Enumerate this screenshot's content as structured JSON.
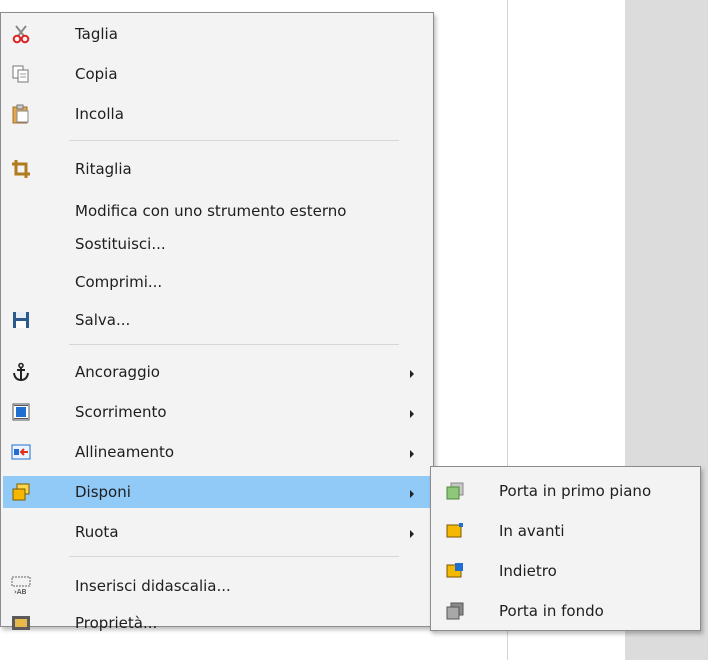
{
  "context_menu": {
    "items": [
      {
        "label": "Taglia",
        "icon": "scissors-icon",
        "submenu": false
      },
      {
        "label": "Copia",
        "icon": "copy-icon",
        "submenu": false
      },
      {
        "label": "Incolla",
        "icon": "paste-icon",
        "submenu": false
      },
      {
        "label": "Ritaglia",
        "icon": "crop-icon",
        "submenu": false
      },
      {
        "label": "Modifica con uno strumento esterno",
        "icon": "",
        "submenu": false
      },
      {
        "label": "Sostituisci...",
        "icon": "",
        "submenu": false
      },
      {
        "label": "Comprimi...",
        "icon": "",
        "submenu": false
      },
      {
        "label": "Salva...",
        "icon": "save-icon",
        "submenu": false
      },
      {
        "label": "Ancoraggio",
        "icon": "anchor-icon",
        "submenu": true
      },
      {
        "label": "Scorrimento",
        "icon": "wrap-icon",
        "submenu": true
      },
      {
        "label": "Allineamento",
        "icon": "align-icon",
        "submenu": true
      },
      {
        "label": "Disponi",
        "icon": "arrange-icon",
        "submenu": true,
        "highlighted": true
      },
      {
        "label": "Ruota",
        "icon": "",
        "submenu": true
      },
      {
        "label": "Inserisci didascalia...",
        "icon": "caption-icon",
        "submenu": false
      },
      {
        "label": "Proprietà...",
        "icon": "properties-icon",
        "submenu": false
      }
    ]
  },
  "arrange_submenu": {
    "items": [
      {
        "label": "Porta in primo piano",
        "icon": "bring-to-front-icon"
      },
      {
        "label": "In avanti",
        "icon": "bring-forward-icon"
      },
      {
        "label": "Indietro",
        "icon": "send-backward-icon"
      },
      {
        "label": "Porta in fondo",
        "icon": "send-to-back-icon"
      }
    ]
  },
  "colors": {
    "highlight": "#91c9f7",
    "menu_background": "#f3f3f3"
  }
}
